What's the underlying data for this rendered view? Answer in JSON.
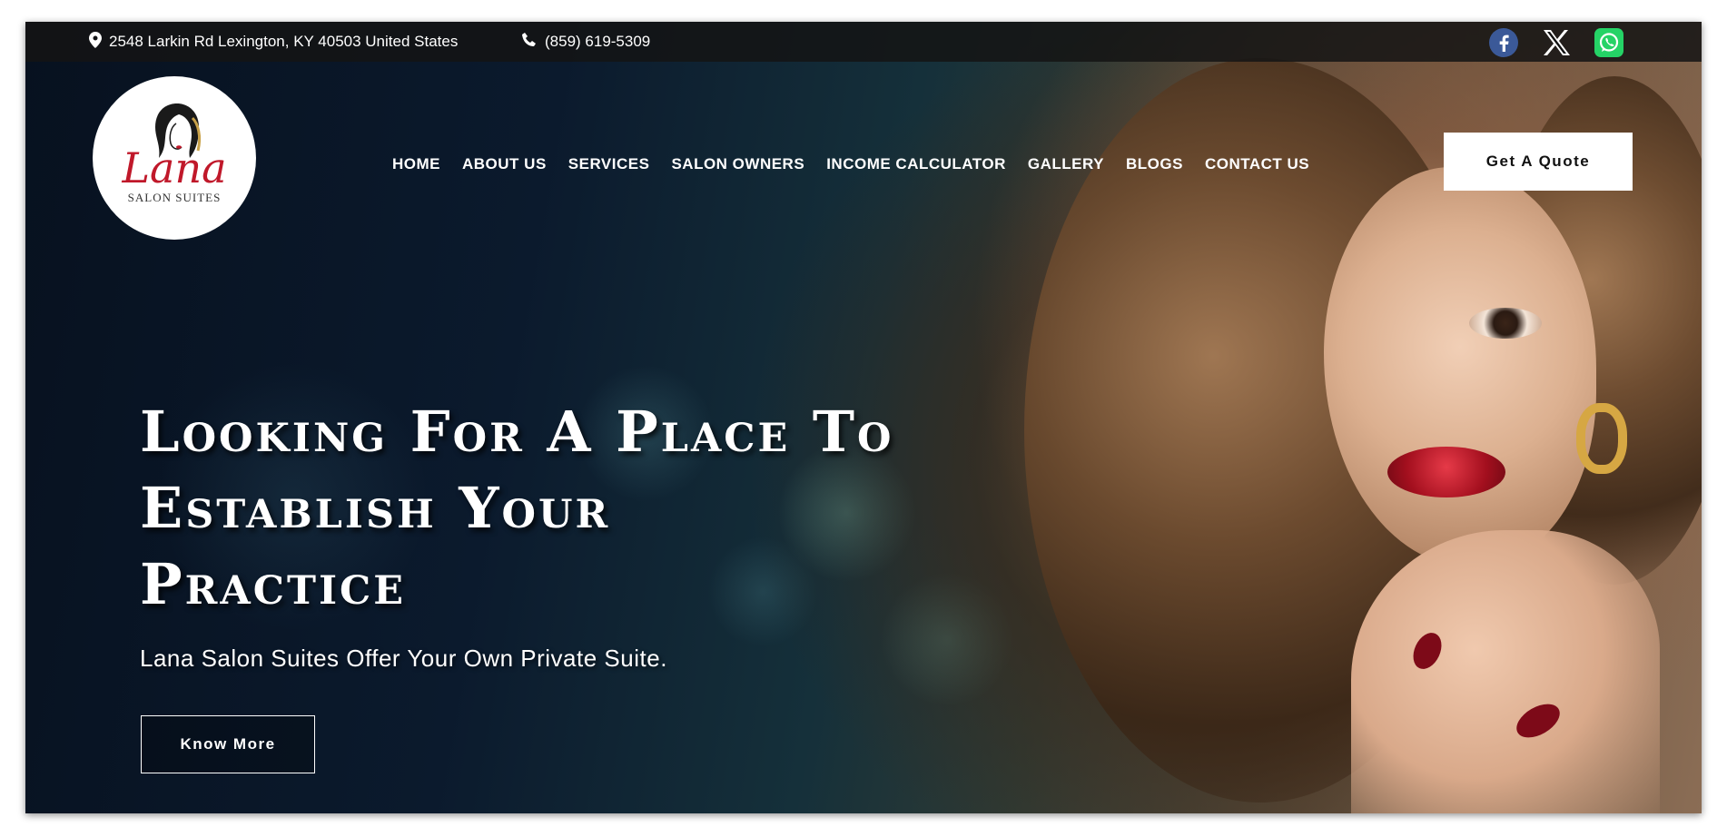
{
  "topbar": {
    "address": "2548 Larkin Rd Lexington, KY 40503 United States",
    "phone": "(859) 619-5309",
    "social": [
      {
        "name": "facebook-icon",
        "color": "#3b5998"
      },
      {
        "name": "x-icon",
        "color": "#ffffff"
      },
      {
        "name": "whatsapp-icon",
        "color": "#25d366"
      }
    ]
  },
  "logo": {
    "script": "Lana",
    "subtitle": "SALON SUITES"
  },
  "nav": {
    "items": [
      "HOME",
      "ABOUT US",
      "SERVICES",
      "SALON OWNERS",
      "INCOME CALCULATOR",
      "GALLERY",
      "BLOGS",
      "CONTACT US"
    ]
  },
  "header": {
    "quote_label": "Get A Quote"
  },
  "hero": {
    "title_line1": "Looking For A Place To",
    "title_line2": "Establish Your",
    "title_line3": "Practice",
    "subtitle": "Lana Salon Suites Offer Your Own Private Suite.",
    "cta_label": "Know More"
  },
  "colors": {
    "accent": "#c0182a",
    "dark": "#07111f"
  }
}
